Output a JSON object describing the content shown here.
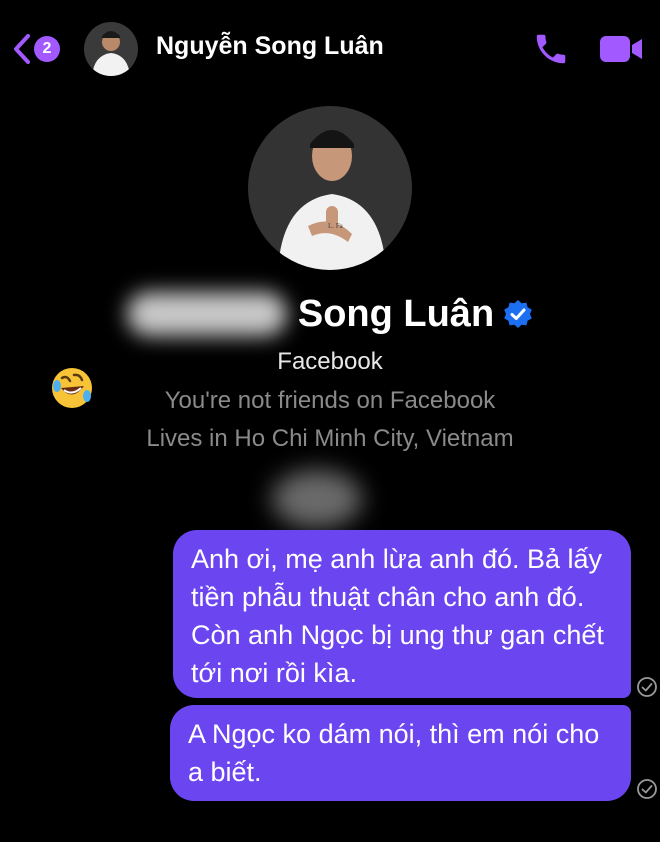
{
  "header": {
    "back_count": "2",
    "contact_name": "Nguyễn Song Luân",
    "accent_color": "#a259ff"
  },
  "profile": {
    "name_visible": "Song Luân",
    "verified": true,
    "platform": "Facebook",
    "friend_status": "You're not friends on Facebook",
    "location": "Lives in Ho Chi Minh City, Vietnam"
  },
  "reaction_emoji": "rolling-on-floor-laughing-emoji",
  "messages": [
    {
      "text": "Anh ơi, mẹ anh lừa anh đó. Bả lấy tiền phẫu thuật chân cho anh đó. Còn anh Ngọc bị ung thư gan chết tới nơi rồi kìa.",
      "status": "sent"
    },
    {
      "text": "A Ngọc ko dám nói, thì em nói cho a biết.",
      "status": "sent"
    }
  ],
  "colors": {
    "bubble": "#6b46f0",
    "background": "#000000",
    "verified_badge": "#1d6ff2"
  }
}
